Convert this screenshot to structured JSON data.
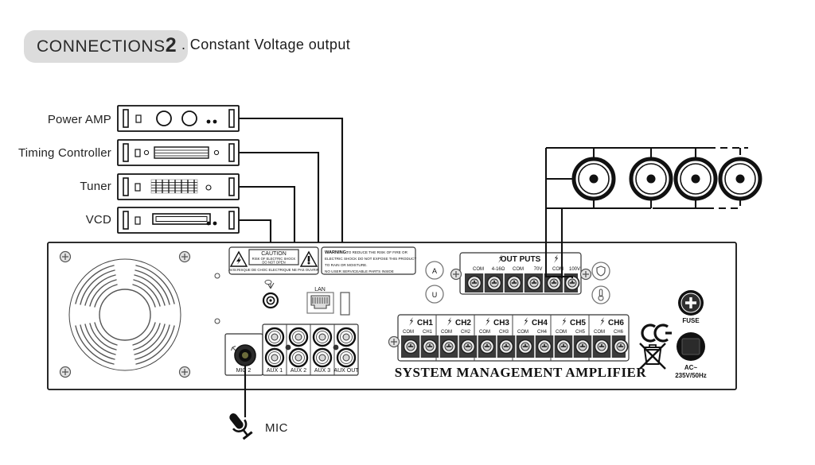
{
  "header": {
    "pill_text": "CONNECTIONS",
    "pill_number": "2",
    "rest_text": ". Constant   Voltage   output"
  },
  "sources": [
    {
      "label": "Power AMP",
      "name": "power-amp"
    },
    {
      "label": "Timing Controller",
      "name": "timing-controller"
    },
    {
      "label": "Tuner",
      "name": "tuner"
    },
    {
      "label": "VCD",
      "name": "vcd"
    }
  ],
  "mic": {
    "label": "MIC"
  },
  "amplifier": {
    "brand_text": "SYSTEM MANAGEMENT AMPLIFIER",
    "caution": {
      "title": "CAUTION",
      "line1": "RISK OF ELECTRIC SHOCK",
      "line2": "DO NOT OPEN",
      "bottom": "AVIS:RISQUE DE CHOC ELECTRIQUE NE PAS OUVRIR"
    },
    "warning": {
      "title": "WARNING:",
      "line1": "TO REDUCE THE RISK OF FIRE OR",
      "line2": "ELECTRIC SHOCK DO NOT EXPOSE THIS PRODUCT",
      "line3": "TO RAIN OR MOISTURE.",
      "line4": "NO USER SERVICEABLE  PARTS INSIDE"
    },
    "lan_label": "LAN",
    "mic2_label": "MIC 2",
    "aux_labels": [
      "AUX 1",
      "AUX 2",
      "AUX 3",
      "AUX OUT"
    ],
    "outputs": {
      "title": "OUT PUTS",
      "terminals": [
        "COM",
        "4-16Ω",
        "COM",
        "70V",
        "COM",
        "100V"
      ]
    },
    "channels": [
      {
        "title": "CH1",
        "com": "COM",
        "hot": "CH1"
      },
      {
        "title": "CH2",
        "com": "COM",
        "hot": "CH2"
      },
      {
        "title": "CH3",
        "com": "COM",
        "hot": "CH3"
      },
      {
        "title": "CH4",
        "com": "COM",
        "hot": "CH4"
      },
      {
        "title": "CH5",
        "com": "COM",
        "hot": "CH5"
      },
      {
        "title": "CH6",
        "com": "COM",
        "hot": "CH6"
      }
    ],
    "status_icons": [
      {
        "name": "circled-a-icon",
        "glyph": "A"
      },
      {
        "name": "circled-u-icon",
        "glyph": "U"
      }
    ],
    "protect_icons": [
      "shield-icon",
      "thermometer-icon"
    ],
    "fuse_label": "FUSE",
    "ac_label_line1": "AC~",
    "ac_label_line2": "235V/50Hz",
    "ce_mark": "CE",
    "weee_mark": "crossed-out-wheelie-bin"
  },
  "speakers": {
    "count": 4,
    "dashed_last": true
  },
  "colors": {
    "pill_bg": "#dcdcdc",
    "line": "#111111",
    "panel_fill": "#ffffff",
    "terminal_dark": "#3b3b3b",
    "text": "#1c1c1c"
  }
}
